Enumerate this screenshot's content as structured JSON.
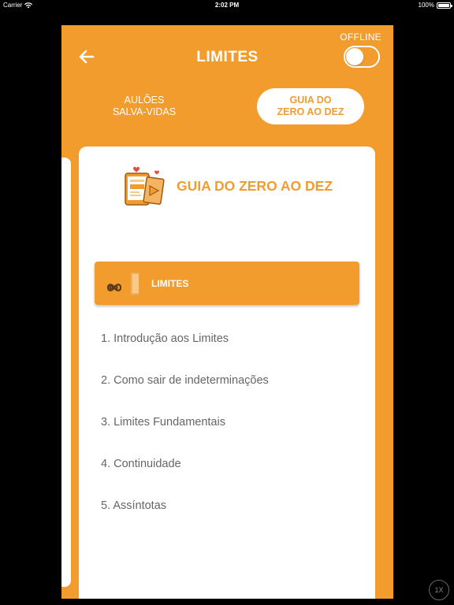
{
  "status_bar": {
    "carrier": "Carrier",
    "time": "2:02 PM",
    "battery": "100%"
  },
  "header": {
    "title": "LIMITES",
    "offline_label": "OFFLINE",
    "offline_enabled": false
  },
  "tabs": [
    {
      "line1": "AULÕES",
      "line2": "SALVA-VIDAS",
      "active": false
    },
    {
      "line1": "GUIA DO",
      "line2": "ZERO AO DEZ",
      "active": true
    }
  ],
  "guide": {
    "title": "GUIA DO ZERO AO DEZ"
  },
  "section": {
    "symbol": "∞",
    "label": "LIMITES"
  },
  "topics": [
    "1. Introdução aos Limites",
    "2. Como sair de indeterminações",
    "3. Limites Fundamentais",
    "4. Continuidade",
    "5. Assíntotas"
  ],
  "speed_badge": "1X",
  "colors": {
    "accent": "#F39C2E",
    "card": "#FFFFFF",
    "text_muted": "#666666"
  },
  "icons": {
    "back": "arrow-left-icon",
    "guide": "tablet-video-heart-icon",
    "section": "infinity-book-icon",
    "wifi": "wifi-icon",
    "battery": "battery-icon"
  }
}
